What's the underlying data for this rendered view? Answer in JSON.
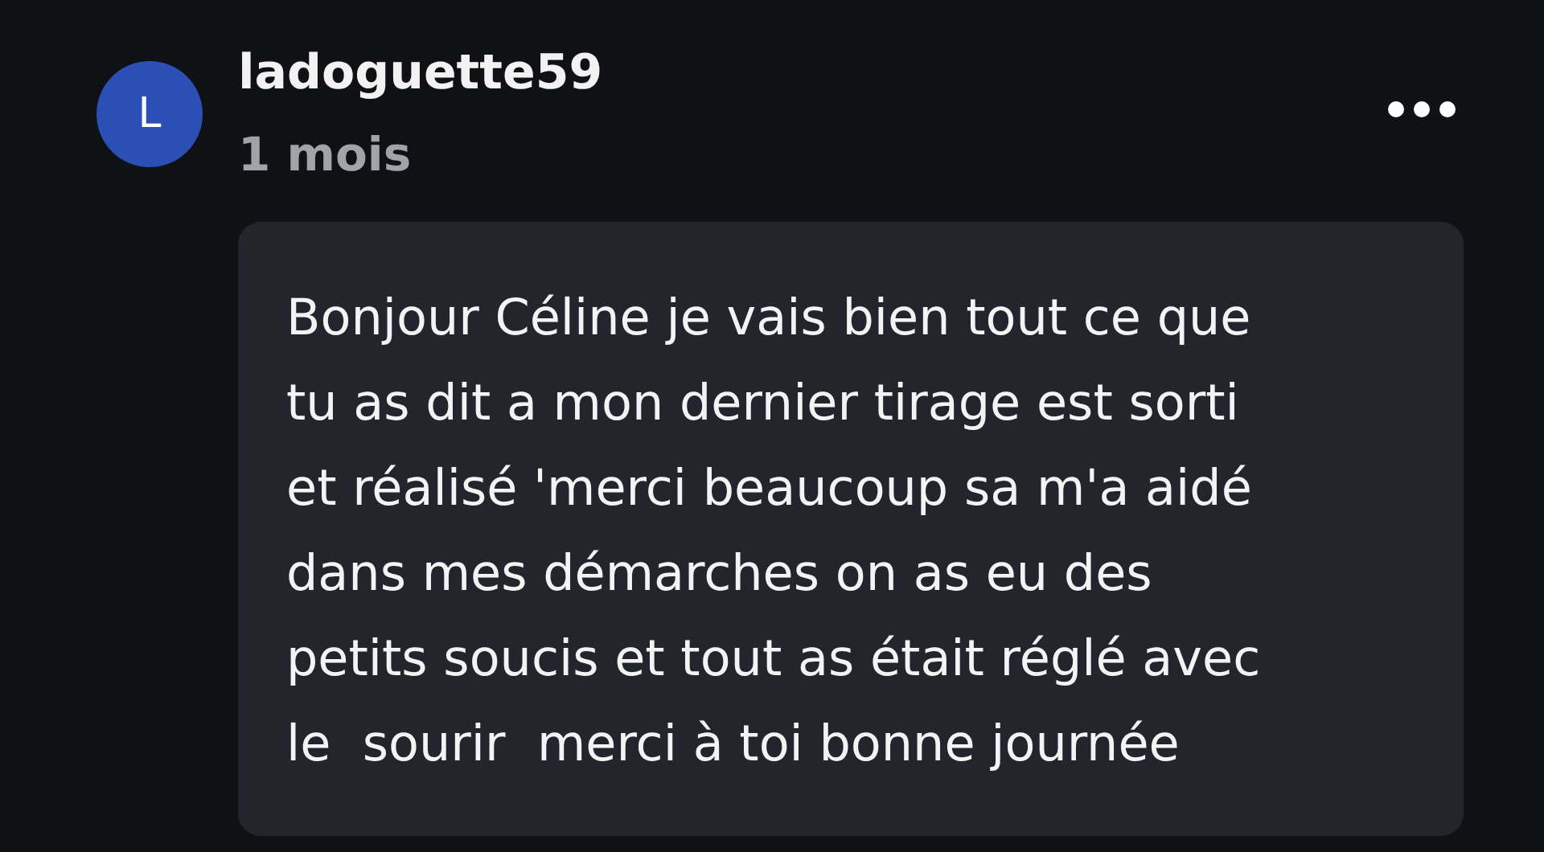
{
  "comment": {
    "avatar_letter": "L",
    "author": "ladoguette59",
    "time": "1 mois",
    "body": "Bonjour Céline je vais bien tout ce que\ntu as dit a mon dernier tirage est sorti\net réalisé 'merci beaucoup sa m'a aidé\ndans mes démarches on as eu des\npetits soucis et tout as était réglé avec\nle  sourir  merci à toi bonne journée"
  }
}
